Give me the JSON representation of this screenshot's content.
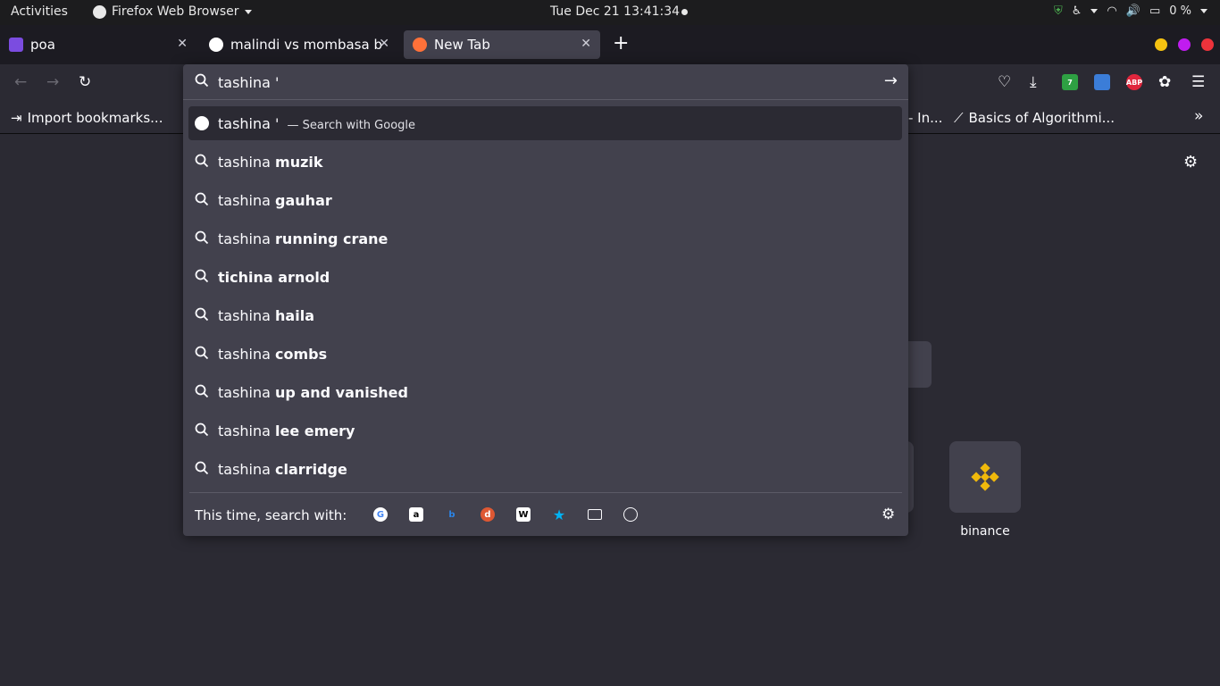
{
  "topbar": {
    "activities": "Activities",
    "app_name": "Firefox Web Browser",
    "clock": "Tue Dec 21  13:41:34",
    "battery": "0 %"
  },
  "tabs": [
    {
      "title": "poa",
      "favicon_color": "#7b4ce0"
    },
    {
      "title": "malindi vs mombasa b",
      "favicon_color": "#4285f4"
    },
    {
      "title": "New Tab",
      "favicon_color": "#ff7139"
    }
  ],
  "bookmarks": {
    "import": "Import bookmarks...",
    "partial": "- In...",
    "algorithms": "Basics of Algorithmi..."
  },
  "urlbar": {
    "query": "tashina '",
    "search_with_label": "— Search with Google",
    "suggestions": [
      {
        "prefix": "tashina ",
        "bold": "muzik"
      },
      {
        "prefix": "tashina ",
        "bold": "gauhar"
      },
      {
        "prefix": "tashina ",
        "bold": "running crane"
      },
      {
        "prefix": "",
        "bold": "tichina arnold"
      },
      {
        "prefix": "tashina ",
        "bold": "haila"
      },
      {
        "prefix": "tashina ",
        "bold": "combs"
      },
      {
        "prefix": "tashina ",
        "bold": "up and vanished"
      },
      {
        "prefix": "tashina ",
        "bold": "lee emery"
      },
      {
        "prefix": "tashina ",
        "bold": "clarridge"
      }
    ],
    "oneoff_label": "This time, search with:"
  },
  "content": {
    "site_label": "binance"
  },
  "colors": {
    "accent_yellow": "#f0b90b",
    "win_min": "#f5c211",
    "win_max": "#c01cf0",
    "win_close": "#ed333b"
  }
}
